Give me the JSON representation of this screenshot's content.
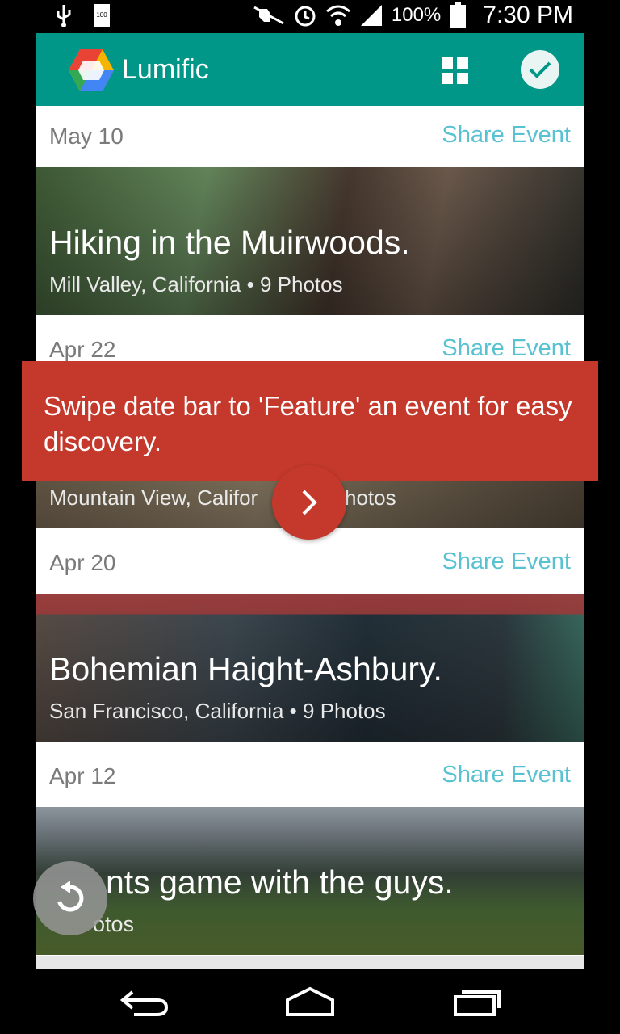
{
  "status_bar": {
    "battery_percent": "100%",
    "time": "7:30 PM",
    "small_battery_label": "100",
    "icons": [
      "usb-icon",
      "battery-small-icon",
      "mute-icon",
      "alarm-icon",
      "wifi-icon",
      "signal-icon",
      "battery-icon"
    ]
  },
  "app_bar": {
    "title": "Lumific",
    "accent_color": "#009688",
    "icons": [
      "app-logo-icon",
      "grid-view-icon",
      "check-icon"
    ]
  },
  "events": [
    {
      "date": "May 10",
      "share_label": "Share Event",
      "title": "Hiking in the Muirwoods.",
      "subtitle": "Mill Valley, California • 9 Photos"
    },
    {
      "date": "Apr 22",
      "share_label": "Share Event",
      "title": "",
      "subtitle": "Mountain View, Califor"
    },
    {
      "date": "Apr 20",
      "share_label": "Share Event",
      "title": "Bohemian Haight-Ashbury.",
      "subtitle": "San Francisco, California • 9 Photos"
    },
    {
      "date": "Apr 12",
      "share_label": "Share Event",
      "title": "nts game with the guys.",
      "subtitle": "otos"
    }
  ],
  "event2_tail": "hotos",
  "tooltip": {
    "text": "Swipe date bar to 'Feature' an event for easy discovery.",
    "color": "#c4392c",
    "next_icon": "chevron-right-icon"
  },
  "share_color": "#58c2d2",
  "refresh_icon": "refresh-icon",
  "nav_icons": [
    "back-icon",
    "home-icon",
    "recents-icon"
  ]
}
